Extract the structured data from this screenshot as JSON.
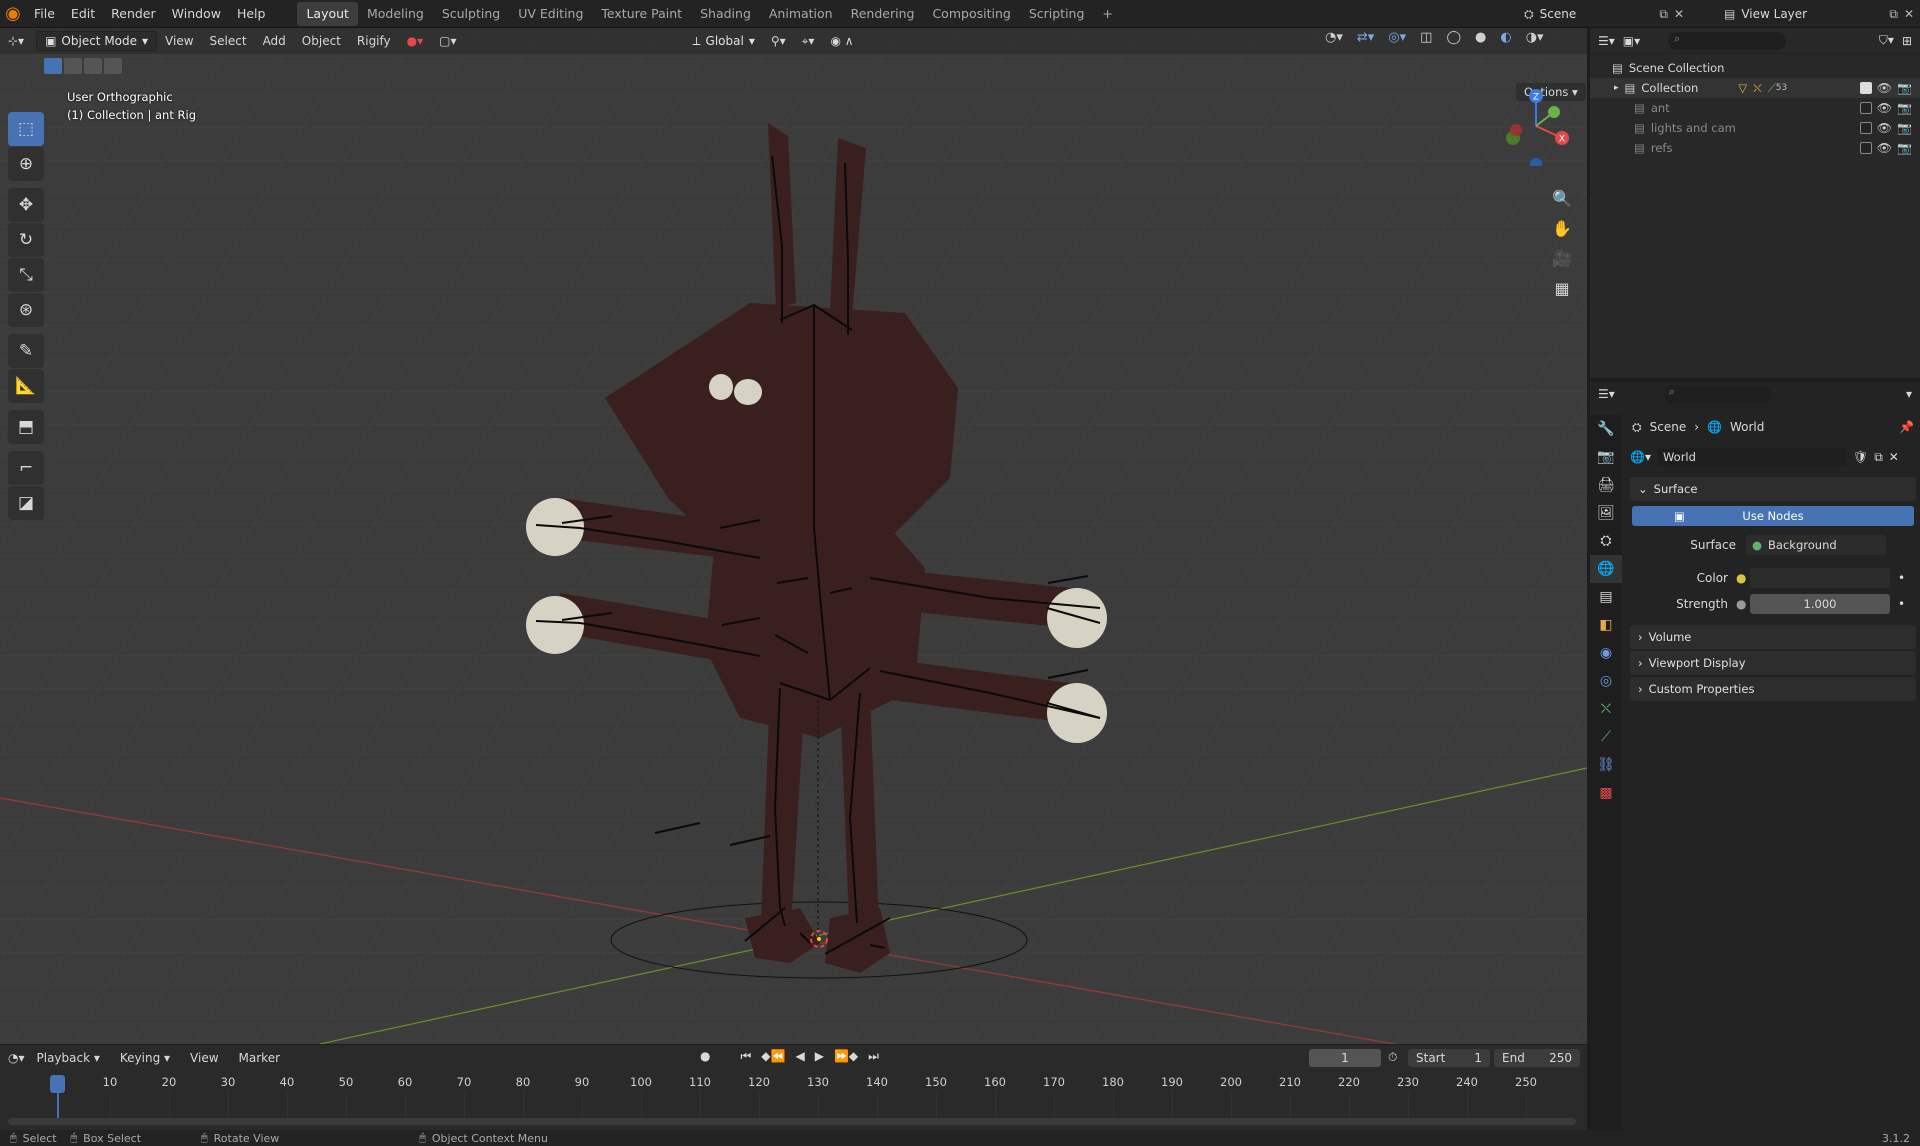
{
  "topbar": {
    "menus": [
      "File",
      "Edit",
      "Render",
      "Window",
      "Help"
    ],
    "workspaces": [
      "Layout",
      "Modeling",
      "Sculpting",
      "UV Editing",
      "Texture Paint",
      "Shading",
      "Animation",
      "Rendering",
      "Compositing",
      "Scripting"
    ],
    "active_workspace": "Layout",
    "add_tab": "+",
    "scene_name": "Scene",
    "view_layer": "View Layer"
  },
  "viewport": {
    "mode": "Object Mode",
    "menus": [
      "View",
      "Select",
      "Add",
      "Object",
      "Rigify"
    ],
    "transform_orientation": "Global",
    "view_name": "User Orthographic",
    "context_info": "(1) Collection | ant Rig",
    "options_label": "Options",
    "accent": "#4772b3",
    "character_color": "#3a1f1f",
    "hand_color": "#d6d3c4"
  },
  "outliner": {
    "root": "Scene Collection",
    "items": [
      {
        "label": "Collection",
        "extra": "53",
        "checked": true
      },
      {
        "label": "ant",
        "checked": false
      },
      {
        "label": "lights and cam",
        "checked": false
      },
      {
        "label": "refs",
        "checked": false
      }
    ]
  },
  "properties": {
    "breadcrumb": [
      "Scene",
      "World"
    ],
    "datablock": "World",
    "surface_panel": "Surface",
    "use_nodes": "Use Nodes",
    "surface_label": "Surface",
    "surface_value": "Background",
    "color_label": "Color",
    "strength_label": "Strength",
    "strength_value": "1.000",
    "panels": [
      "Volume",
      "Viewport Display",
      "Custom Properties"
    ]
  },
  "timeline": {
    "menus": [
      "Playback",
      "Keying",
      "View",
      "Marker"
    ],
    "current_frame": "1",
    "start_label": "Start",
    "start_value": "1",
    "end_label": "End",
    "end_value": "250",
    "ticks": [
      "1",
      "10",
      "20",
      "30",
      "40",
      "50",
      "60",
      "70",
      "80",
      "90",
      "100",
      "110",
      "120",
      "130",
      "140",
      "150",
      "160",
      "170",
      "180",
      "190",
      "200",
      "210",
      "220",
      "230",
      "240",
      "250"
    ]
  },
  "statusbar": {
    "items": [
      "Select",
      "Box Select",
      "Rotate View",
      "Object Context Menu"
    ],
    "version": "3.1.2"
  }
}
